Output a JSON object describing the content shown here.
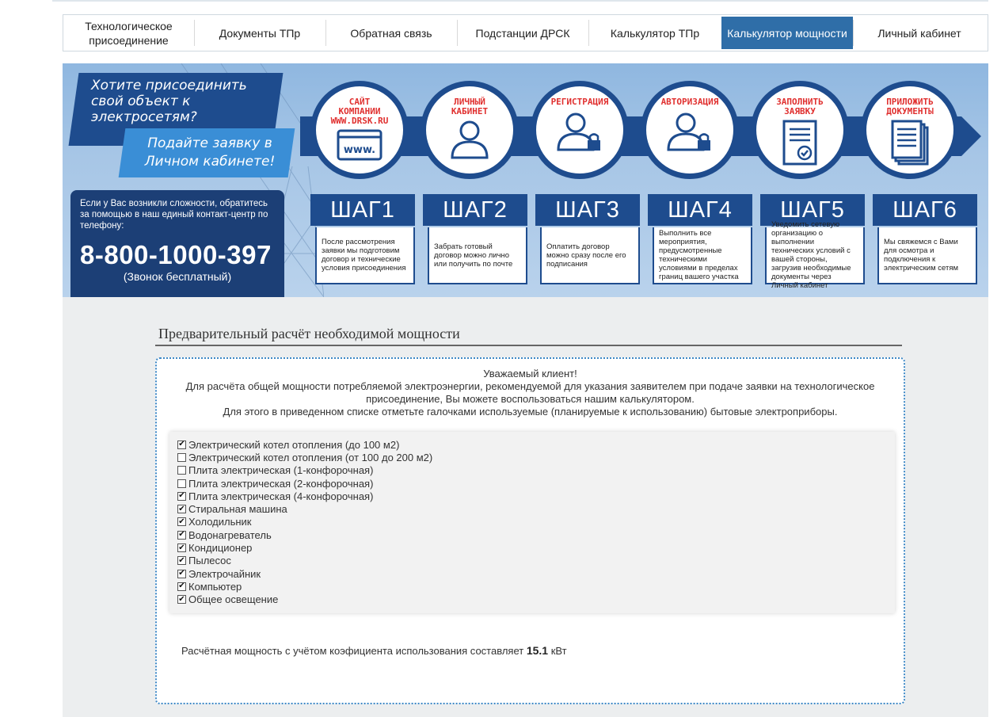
{
  "nav": {
    "items": [
      {
        "label": "Технологическое присоединение",
        "active": false
      },
      {
        "label": "Документы ТПр",
        "active": false
      },
      {
        "label": "Обратная связь",
        "active": false
      },
      {
        "label": "Подстанции ДРСК",
        "active": false
      },
      {
        "label": "Калькулятор ТПр",
        "active": false
      },
      {
        "label": "Калькулятор мощности",
        "active": true
      },
      {
        "label": "Личный кабинет",
        "active": false
      }
    ]
  },
  "banner": {
    "promo_question": "Хотите присоединить свой объект к электросетям?",
    "promo_action": "Подайте заявку в Личном кабинете!",
    "contact_help": "Если у Вас возникли сложности, обратитесь за помощью в наш единый контакт-центр по телефону:",
    "phone": "8-800-1000-397",
    "phone_note": "(Звонок бесплатный)",
    "circles": [
      {
        "label": "САЙТ КОМПАНИИ WWW.DRSK.RU",
        "icon": "browser-window-icon",
        "icon_text": "www."
      },
      {
        "label": "ЛИЧНЫЙ КАБИНЕТ",
        "icon": "user-icon"
      },
      {
        "label": "РЕГИСТРАЦИЯ",
        "icon": "user-lock-icon"
      },
      {
        "label": "АВТОРИЗАЦИЯ",
        "icon": "user-lock-icon"
      },
      {
        "label": "ЗАПОЛНИТЬ ЗАЯВКУ",
        "icon": "form-check-icon"
      },
      {
        "label": "ПРИЛОЖИТЬ ДОКУМЕНТЫ",
        "icon": "documents-icon"
      }
    ],
    "steps": [
      {
        "title": "ШАГ1",
        "text": "После рассмотрения заявки мы подготовим договор и технические условия присоединения"
      },
      {
        "title": "ШАГ2",
        "text": "Забрать готовый договор можно лично или получить по почте"
      },
      {
        "title": "ШАГ3",
        "text": "Оплатить договор можно сразу после его подписания"
      },
      {
        "title": "ШАГ4",
        "text": "Выполнить все мероприятия, предусмотренные техническими условиями в пределах границ вашего участка"
      },
      {
        "title": "ШАГ5",
        "text": "Уведомить сетевую организацию о выполнении технических условий с вашей стороны, загрузив необходимые документы через Личный кабинет"
      },
      {
        "title": "ШАГ6",
        "text": "Мы свяжемся с Вами для осмотра и подключения к электрическим сетям"
      }
    ]
  },
  "calculator": {
    "title": "Предварительный расчёт необходимой мощности",
    "intro_greeting": "Уважаемый клиент!",
    "intro_text": "Для расчёта общей мощности потребляемой электроэнергии, рекомендуемой для указания заявителем при подаче заявки на технологическое присоединение, Вы можете воспользоваться нашим калькулятором.",
    "intro_instruction": "Для этого в приведенном списке отметьте галочками используемые (планируемые к использованию) бытовые электроприборы.",
    "appliances": [
      {
        "label": "Электрический котел отопления (до 100 м2)",
        "checked": true
      },
      {
        "label": "Электрический котел отопления (от 100 до 200 м2)",
        "checked": false
      },
      {
        "label": "Плита электрическая (1-конфорочная)",
        "checked": false
      },
      {
        "label": "Плита электрическая (2-конфорочная)",
        "checked": false
      },
      {
        "label": "Плита электрическая (4-конфорочная)",
        "checked": true
      },
      {
        "label": "Стиральная машина",
        "checked": true
      },
      {
        "label": "Холодильник",
        "checked": true
      },
      {
        "label": "Водонагреватель",
        "checked": true
      },
      {
        "label": "Кондиционер",
        "checked": true
      },
      {
        "label": "Пылесос",
        "checked": true
      },
      {
        "label": "Электрочайник",
        "checked": true
      },
      {
        "label": "Компьютер",
        "checked": true
      },
      {
        "label": "Общее освещение",
        "checked": true
      }
    ],
    "result_prefix": "Расчётная мощность с учётом коэфициента использования составляет",
    "result_value": "15.1",
    "result_unit": "кВт"
  },
  "colors": {
    "accent": "#2f6ea8",
    "banner_dark": "#1e4c8e",
    "step_label": "#e0302f",
    "frame": "#3d88c6"
  }
}
